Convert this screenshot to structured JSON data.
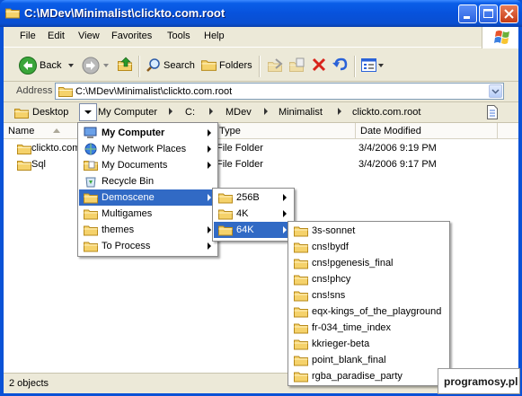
{
  "window": {
    "title": "C:\\MDev\\Minimalist\\clickto.com.root"
  },
  "menubar": {
    "items": [
      "File",
      "Edit",
      "View",
      "Favorites",
      "Tools",
      "Help"
    ]
  },
  "toolbar": {
    "back_label": "Back",
    "search_label": "Search",
    "folders_label": "Folders"
  },
  "address": {
    "label": "Address",
    "value": "C:\\MDev\\Minimalist\\clickto.com.root"
  },
  "crumbs": {
    "desktop": "Desktop",
    "items": [
      "My Computer",
      "C:",
      "MDev",
      "Minimalist",
      "clickto.com.root"
    ]
  },
  "columns": {
    "name": "Name",
    "type": "Type",
    "date": "Date Modified"
  },
  "files": [
    {
      "name": "clickto.com",
      "type": "File Folder",
      "date": "3/4/2006 9:19 PM"
    },
    {
      "name": "Sql",
      "type": "File Folder",
      "date": "3/4/2006 9:17 PM"
    }
  ],
  "status": {
    "text": "2 objects"
  },
  "menu1": {
    "items": [
      {
        "label": "My Computer",
        "icon": "computer-icon",
        "bold": true,
        "submenu": true
      },
      {
        "label": "My Network Places",
        "icon": "network-icon",
        "submenu": true
      },
      {
        "label": "My Documents",
        "icon": "documents-icon",
        "submenu": true
      },
      {
        "label": "Recycle Bin",
        "icon": "recycle-bin-icon",
        "submenu": false
      },
      {
        "label": "Demoscene",
        "icon": "folder-icon",
        "submenu": true,
        "highlighted": true
      },
      {
        "label": "Multigames",
        "icon": "folder-icon",
        "submenu": false
      },
      {
        "label": "themes",
        "icon": "folder-icon",
        "submenu": true
      },
      {
        "label": "To Process",
        "icon": "folder-icon",
        "submenu": true
      }
    ]
  },
  "menu2": {
    "items": [
      {
        "label": "256B",
        "submenu": true
      },
      {
        "label": "4K",
        "submenu": true
      },
      {
        "label": "64K",
        "submenu": true,
        "highlighted": true
      }
    ]
  },
  "menu3": {
    "items": [
      "3s-sonnet",
      "cns!bydf",
      "cns!pgenesis_final",
      "cns!phcy",
      "cns!sns",
      "eqx-kings_of_the_playground",
      "fr-034_time_index",
      "kkrieger-beta",
      "point_blank_final",
      "rgba_paradise_party"
    ]
  },
  "watermark": {
    "text": "programosy.pl"
  },
  "colors": {
    "titlebar": "#0752dc",
    "highlight": "#316ac5",
    "folder": "#f5d26b"
  }
}
